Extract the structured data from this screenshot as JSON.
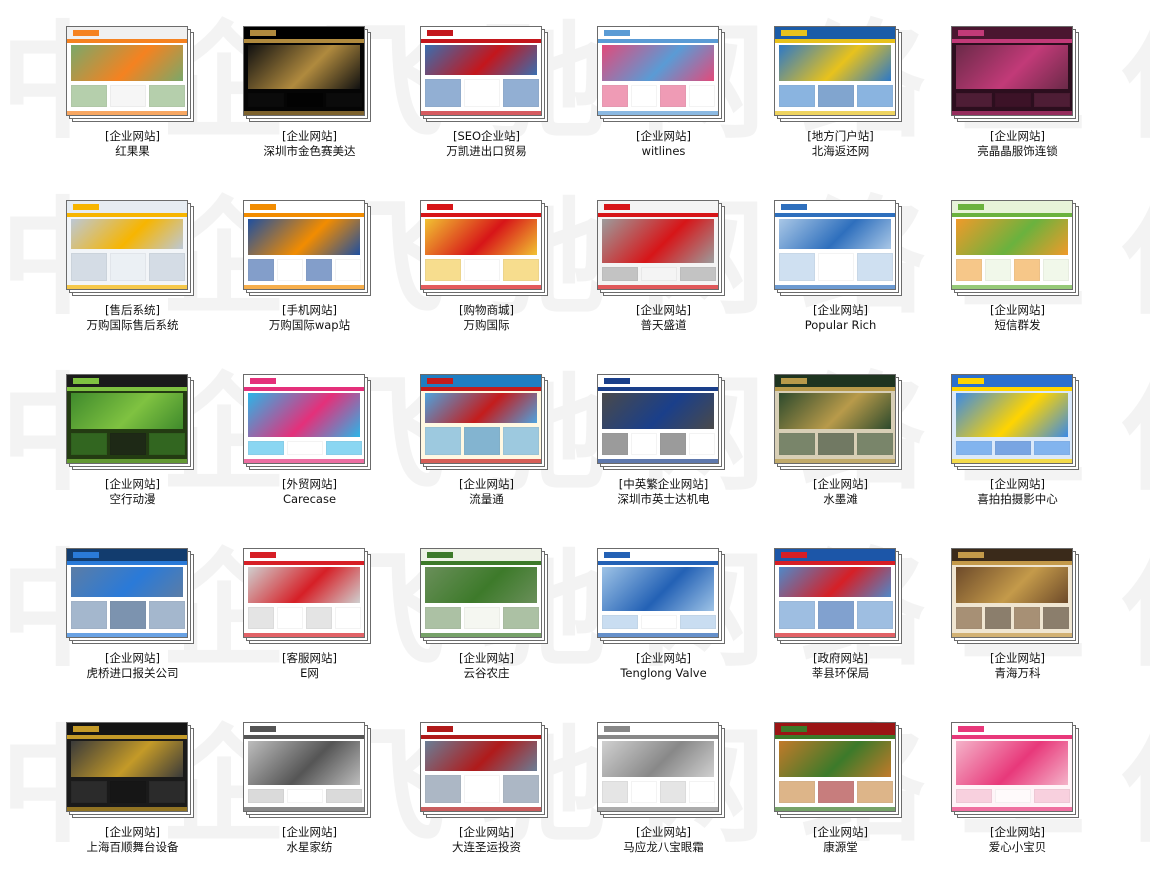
{
  "watermark_text": "中企飞驰网络工作室",
  "items": [
    {
      "category": "[企业网站]",
      "name": "红果果",
      "scheme": {
        "top": "#f0f0f0",
        "accent": "#f58220",
        "body": "#ffffff",
        "img": "#7aa86a"
      }
    },
    {
      "category": "[企业网站]",
      "name": "深圳市金色赛美达",
      "scheme": {
        "top": "#000000",
        "accent": "#b08a3e",
        "body": "#050505",
        "img": "#111111"
      }
    },
    {
      "category": "[SEO企业站]",
      "name": "万凯进出口贸易",
      "scheme": {
        "top": "#ffffff",
        "accent": "#c4161c",
        "body": "#ffffff",
        "img": "#3a6fb0"
      }
    },
    {
      "category": "[企业网站]",
      "name": "witlines",
      "scheme": {
        "top": "#ffffff",
        "accent": "#5a9bd5",
        "body": "#ffffff",
        "img": "#e24a7a"
      }
    },
    {
      "category": "[地方门户站]",
      "name": "北海返还网",
      "scheme": {
        "top": "#1b5ca8",
        "accent": "#e8c21c",
        "body": "#ffffff",
        "img": "#2c78c8"
      }
    },
    {
      "category": "[企业网站]",
      "name": "亮晶晶服饰连锁",
      "scheme": {
        "top": "#4a1630",
        "accent": "#c23a78",
        "body": "#2c0e1e",
        "img": "#6a2a48"
      }
    },
    {
      "category": "[售后系统]",
      "name": "万购国际售后系统",
      "scheme": {
        "top": "#e6ecf2",
        "accent": "#f7b500",
        "body": "#f2f5f8",
        "img": "#bcc8d6"
      }
    },
    {
      "category": "[手机网站]",
      "name": "万购国际wap站",
      "scheme": {
        "top": "#ffffff",
        "accent": "#f28c00",
        "body": "#ffffff",
        "img": "#1e4fa0"
      }
    },
    {
      "category": "[购物商城]",
      "name": "万购国际",
      "scheme": {
        "top": "#ffffff",
        "accent": "#d71518",
        "body": "#ffffff",
        "img": "#f1c232"
      }
    },
    {
      "category": "[企业网站]",
      "name": "普天盛道",
      "scheme": {
        "top": "#f4f4f4",
        "accent": "#d71518",
        "body": "#f4f4f4",
        "img": "#9c9c9c"
      }
    },
    {
      "category": "[企业网站]",
      "name": "Popular Rich",
      "scheme": {
        "top": "#ffffff",
        "accent": "#2e6fbd",
        "body": "#ffffff",
        "img": "#a9c7e6"
      }
    },
    {
      "category": "[企业网站]",
      "name": "短信群发",
      "scheme": {
        "top": "#e7f3d9",
        "accent": "#6ab23e",
        "body": "#ffffff",
        "img": "#f09a2a"
      }
    },
    {
      "category": "[企业网站]",
      "name": "空行动漫",
      "scheme": {
        "top": "#1b1b1b",
        "accent": "#7fc241",
        "body": "#233b12",
        "img": "#3f8a2c"
      }
    },
    {
      "category": "[外贸网站]",
      "name": "Carecase",
      "scheme": {
        "top": "#ffffff",
        "accent": "#e4307a",
        "body": "#ffffff",
        "img": "#2bb5e8"
      }
    },
    {
      "category": "[企业网站]",
      "name": "流量通",
      "scheme": {
        "top": "#1f7ec2",
        "accent": "#c41c1c",
        "body": "#fff8e2",
        "img": "#4ea3de"
      }
    },
    {
      "category": "[中英繁企业网站]",
      "name": "深圳市英士达机电",
      "scheme": {
        "top": "#ffffff",
        "accent": "#1a3f8a",
        "body": "#ffffff",
        "img": "#4a4a4a"
      }
    },
    {
      "category": "[企业网站]",
      "name": "水墨滩",
      "scheme": {
        "top": "#1e3420",
        "accent": "#b89a4a",
        "body": "#d8cfb6",
        "img": "#2d4a2d"
      }
    },
    {
      "category": "[企业网站]",
      "name": "喜拍拍摄影中心",
      "scheme": {
        "top": "#2a6fcf",
        "accent": "#ffd400",
        "body": "#dbe9fa",
        "img": "#3b8ae6"
      }
    },
    {
      "category": "[企业网站]",
      "name": "虎桥进口报关公司",
      "scheme": {
        "top": "#123c6e",
        "accent": "#2a7ad8",
        "body": "#ffffff",
        "img": "#5b7da6"
      }
    },
    {
      "category": "[客服网站]",
      "name": "E网",
      "scheme": {
        "top": "#ffffff",
        "accent": "#d61f26",
        "body": "#ffffff",
        "img": "#cfcfcf"
      }
    },
    {
      "category": "[企业网站]",
      "name": "云谷农庄",
      "scheme": {
        "top": "#eef2e6",
        "accent": "#3d7a2a",
        "body": "#ffffff",
        "img": "#6a8f5a"
      }
    },
    {
      "category": "[企业网站]",
      "name": "Tenglong Valve",
      "scheme": {
        "top": "#ffffff",
        "accent": "#2361b5",
        "body": "#ffffff",
        "img": "#9ec3e6"
      }
    },
    {
      "category": "[政府网站]",
      "name": "莘县环保局",
      "scheme": {
        "top": "#1c56a8",
        "accent": "#d61f26",
        "body": "#ffffff",
        "img": "#4f89c9"
      }
    },
    {
      "category": "[企业网站]",
      "name": "青海万科",
      "scheme": {
        "top": "#3a2a1a",
        "accent": "#c49a4a",
        "body": "#f0e6d2",
        "img": "#6d4a2a"
      }
    },
    {
      "category": "[企业网站]",
      "name": "上海百顺舞台设备",
      "scheme": {
        "top": "#141414",
        "accent": "#c49a28",
        "body": "#1a1a1a",
        "img": "#3a3a3a"
      }
    },
    {
      "category": "[企业网站]",
      "name": "水星家纺",
      "scheme": {
        "top": "#ffffff",
        "accent": "#555555",
        "body": "#ffffff",
        "img": "#bdbdbd"
      }
    },
    {
      "category": "[企业网站]",
      "name": "大连圣运投资",
      "scheme": {
        "top": "#ffffff",
        "accent": "#b01a1a",
        "body": "#ffffff",
        "img": "#6a7e96"
      }
    },
    {
      "category": "[企业网站]",
      "name": "马应龙八宝眼霜",
      "scheme": {
        "top": "#ffffff",
        "accent": "#888888",
        "body": "#ffffff",
        "img": "#d0d0d0"
      }
    },
    {
      "category": "[企业网站]",
      "name": "康源堂",
      "scheme": {
        "top": "#9b1414",
        "accent": "#3c7a2a",
        "body": "#ffffff",
        "img": "#c27a2a"
      }
    },
    {
      "category": "[企业网站]",
      "name": "爱心小宝贝",
      "scheme": {
        "top": "#ffffff",
        "accent": "#e8387a",
        "body": "#fff4f8",
        "img": "#f4b3c9"
      }
    }
  ]
}
